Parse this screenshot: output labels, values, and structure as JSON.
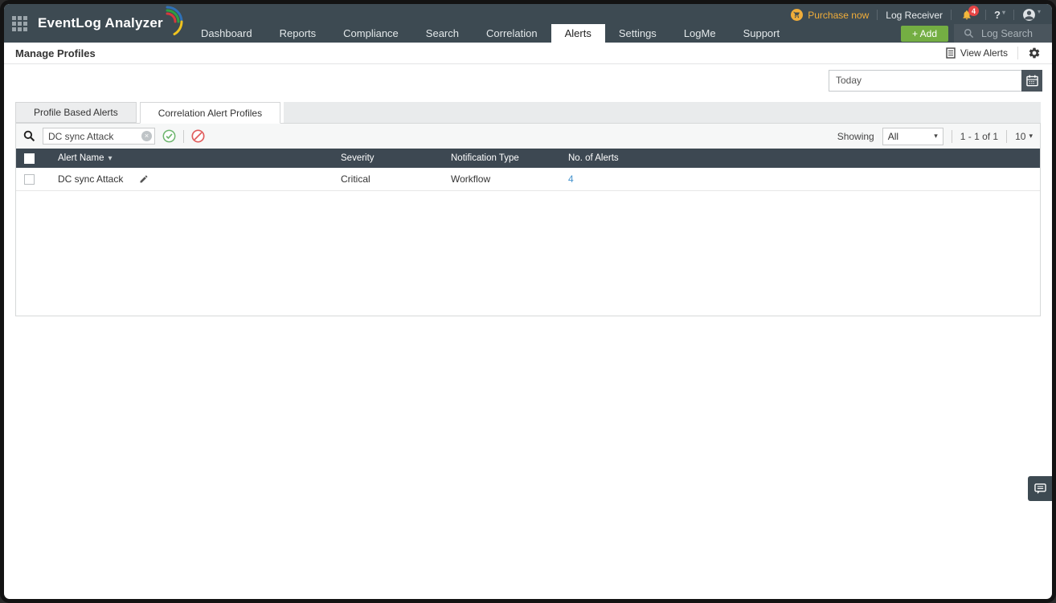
{
  "colors": {
    "header_bg": "#3d4a52",
    "table_header_bg": "#3d4852",
    "accent_green": "#74ae43",
    "purchase_orange": "#f0ad3a",
    "badge_red": "#e64545",
    "link_blue": "#4593ce"
  },
  "header": {
    "product_name": "EventLog Analyzer",
    "nav_items": [
      "Dashboard",
      "Reports",
      "Compliance",
      "Search",
      "Correlation",
      "Alerts",
      "Settings",
      "LogMe",
      "Support"
    ],
    "active_nav": "Alerts",
    "purchase_now_label": "Purchase now",
    "log_receiver_label": "Log Receiver",
    "notification_count": "4",
    "help_label": "?",
    "add_button_label": "+ Add",
    "log_search_label": "Log Search"
  },
  "page": {
    "title": "Manage Profiles",
    "view_alerts_label": "View Alerts",
    "date_range_value": "Today"
  },
  "tabs": [
    {
      "label": "Profile Based Alerts",
      "active": false
    },
    {
      "label": "Correlation Alert Profiles",
      "active": true
    }
  ],
  "toolbar": {
    "search_value": "DC sync Attack",
    "showing_label": "Showing",
    "filter_value": "All",
    "pagination_text": "1 - 1 of 1",
    "page_size": "10"
  },
  "table": {
    "columns": [
      "Alert Name",
      "Severity",
      "Notification Type",
      "No. of Alerts"
    ],
    "rows": [
      {
        "alert_name": "DC sync Attack",
        "severity": "Critical",
        "notification_type": "Workflow",
        "alert_count": "4"
      }
    ]
  },
  "icons": {
    "dropdown_caret": "▾",
    "sort_caret": "▾",
    "clear_x": "×"
  }
}
